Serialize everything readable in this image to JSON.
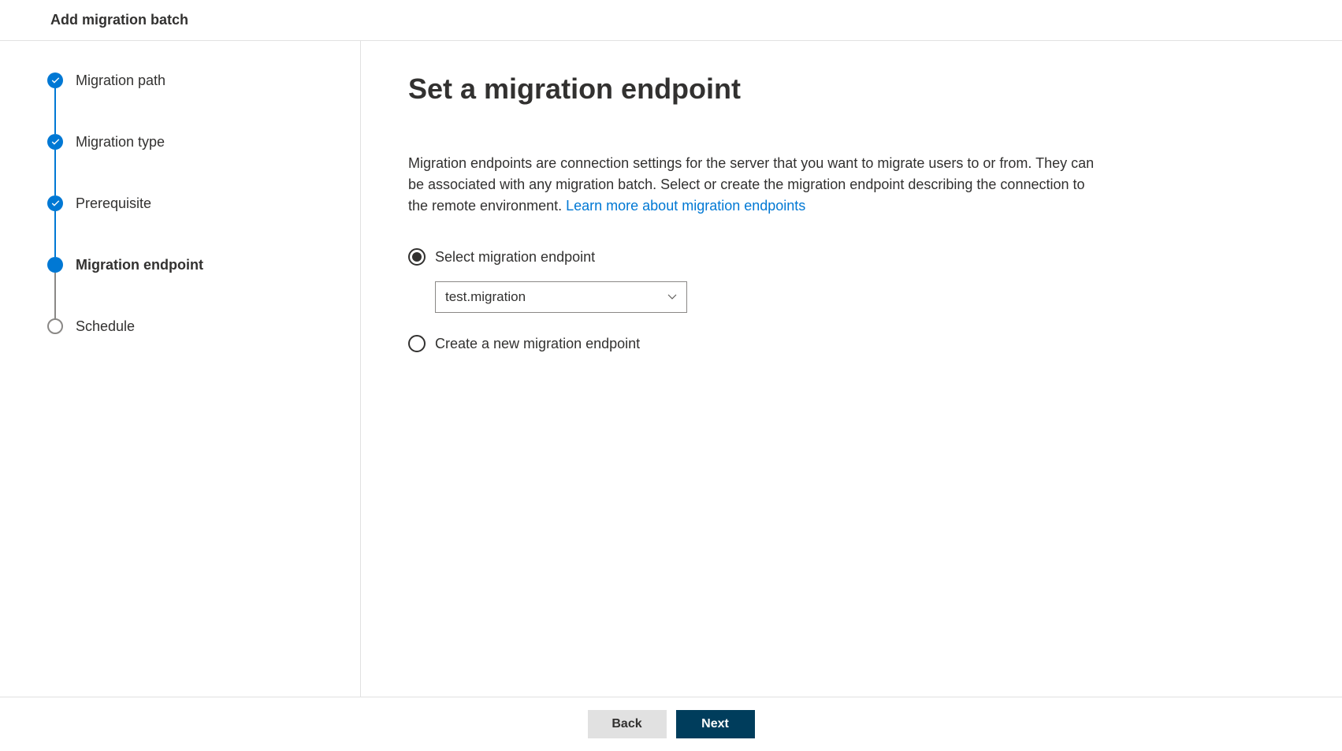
{
  "header": {
    "title": "Add migration batch"
  },
  "sidebar": {
    "steps": [
      {
        "label": "Migration path",
        "state": "completed"
      },
      {
        "label": "Migration type",
        "state": "completed"
      },
      {
        "label": "Prerequisite",
        "state": "completed"
      },
      {
        "label": "Migration endpoint",
        "state": "current"
      },
      {
        "label": "Schedule",
        "state": "pending"
      }
    ]
  },
  "main": {
    "title": "Set a migration endpoint",
    "description": "Migration endpoints are connection settings for the server that you want to migrate users to or from. They can be associated with any migration batch. Select or create the migration endpoint describing the connection to the remote environment. ",
    "link_text": "Learn more about migration endpoints",
    "radio_select_label": "Select migration endpoint",
    "radio_create_label": "Create a new migration endpoint",
    "dropdown_value": "test.migration"
  },
  "footer": {
    "back_label": "Back",
    "next_label": "Next"
  }
}
